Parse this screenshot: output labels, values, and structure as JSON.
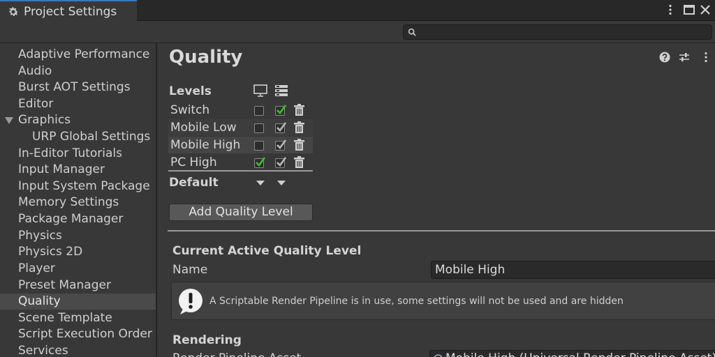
{
  "window": {
    "tab_title": "Project Settings",
    "icons": {
      "tab": "gear-icon",
      "menu": "kebab-menu-icon",
      "maximize": "maximize-icon",
      "close": "close-icon"
    }
  },
  "search": {
    "placeholder": "",
    "icon": "search-icon"
  },
  "sidebar": {
    "items": [
      {
        "label": "Adaptive Performance"
      },
      {
        "label": "Audio"
      },
      {
        "label": "Burst AOT Settings"
      },
      {
        "label": "Editor"
      },
      {
        "label": "Graphics",
        "expanded": true
      },
      {
        "label": "URP Global Settings",
        "child": true
      },
      {
        "label": "In-Editor Tutorials"
      },
      {
        "label": "Input Manager"
      },
      {
        "label": "Input System Package"
      },
      {
        "label": "Memory Settings"
      },
      {
        "label": "Package Manager"
      },
      {
        "label": "Physics"
      },
      {
        "label": "Physics 2D"
      },
      {
        "label": "Player"
      },
      {
        "label": "Preset Manager"
      },
      {
        "label": "Quality",
        "selected": true
      },
      {
        "label": "Scene Template"
      },
      {
        "label": "Script Execution Order"
      },
      {
        "label": "Services"
      }
    ]
  },
  "main": {
    "title": "Quality",
    "header_icons": [
      "help-icon",
      "presets-icon",
      "kebab-menu-icon"
    ],
    "levels": {
      "label": "Levels",
      "column_icons": [
        "monitor-icon",
        "server-icon"
      ],
      "rows": [
        {
          "name": "Switch",
          "desktop": false,
          "server": true,
          "server_green": true
        },
        {
          "name": "Mobile Low",
          "desktop": false,
          "server": true,
          "server_green": false
        },
        {
          "name": "Mobile High",
          "desktop": false,
          "server": true,
          "server_green": false,
          "selected": true
        },
        {
          "name": "PC High",
          "desktop": true,
          "server": true,
          "server_green": false
        }
      ],
      "default_label": "Default"
    },
    "add_button": "Add Quality Level",
    "current": {
      "title": "Current Active Quality Level",
      "name_label": "Name",
      "name_value": "Mobile High",
      "help_message": "A Scriptable Render Pipeline is in use, some settings will not be used and are hidden"
    },
    "rendering": {
      "title": "Rendering",
      "pipeline_label": "Render Pipeline Asset",
      "pipeline_value": "Mobile High (Universal Render Pipeline Asset)"
    }
  },
  "colors": {
    "accent": "#3a79bb",
    "check_green": "#3fbf2f",
    "background": "#383838"
  }
}
